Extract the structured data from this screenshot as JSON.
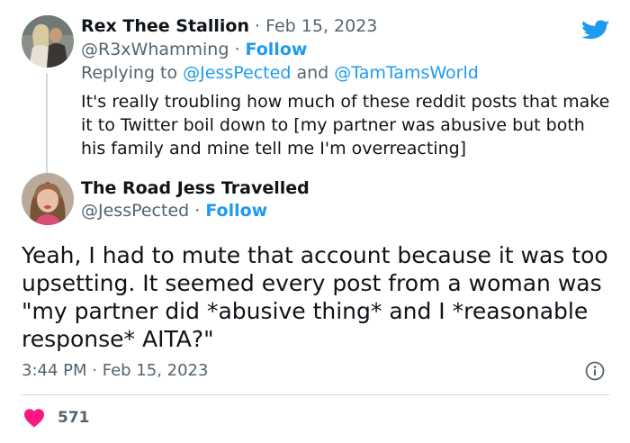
{
  "reply_tweet": {
    "author_name": "Rex Thee Stallion",
    "date": "Feb 15, 2023",
    "handle": "@R3xWhamming",
    "follow_label": "Follow",
    "replying_prefix": "Replying to",
    "replying_user1": "@JessPected",
    "replying_and": "and",
    "replying_user2": "@TamTamsWorld",
    "text": "It's really troubling how much of these reddit posts that make it to Twitter boil down to [my partner was abusive but both his family and mine tell me I'm overreacting]"
  },
  "main_tweet": {
    "author_name": "The Road Jess Travelled",
    "handle": "@JessPected",
    "follow_label": "Follow",
    "text": "Yeah, I had to mute that account because it was too upsetting. It seemed every post from a woman was \"my partner did *abusive thing* and I *reasonable response* AITA?\"",
    "time": "3:44 PM",
    "date": "Feb 15, 2023",
    "like_count": "571"
  },
  "icons": {
    "brand": "twitter-bird-icon",
    "info": "info-icon",
    "like": "heart-icon"
  },
  "colors": {
    "accent": "#1d9bf0",
    "like": "#f91880",
    "text": "#0f1419",
    "muted": "#536471"
  }
}
